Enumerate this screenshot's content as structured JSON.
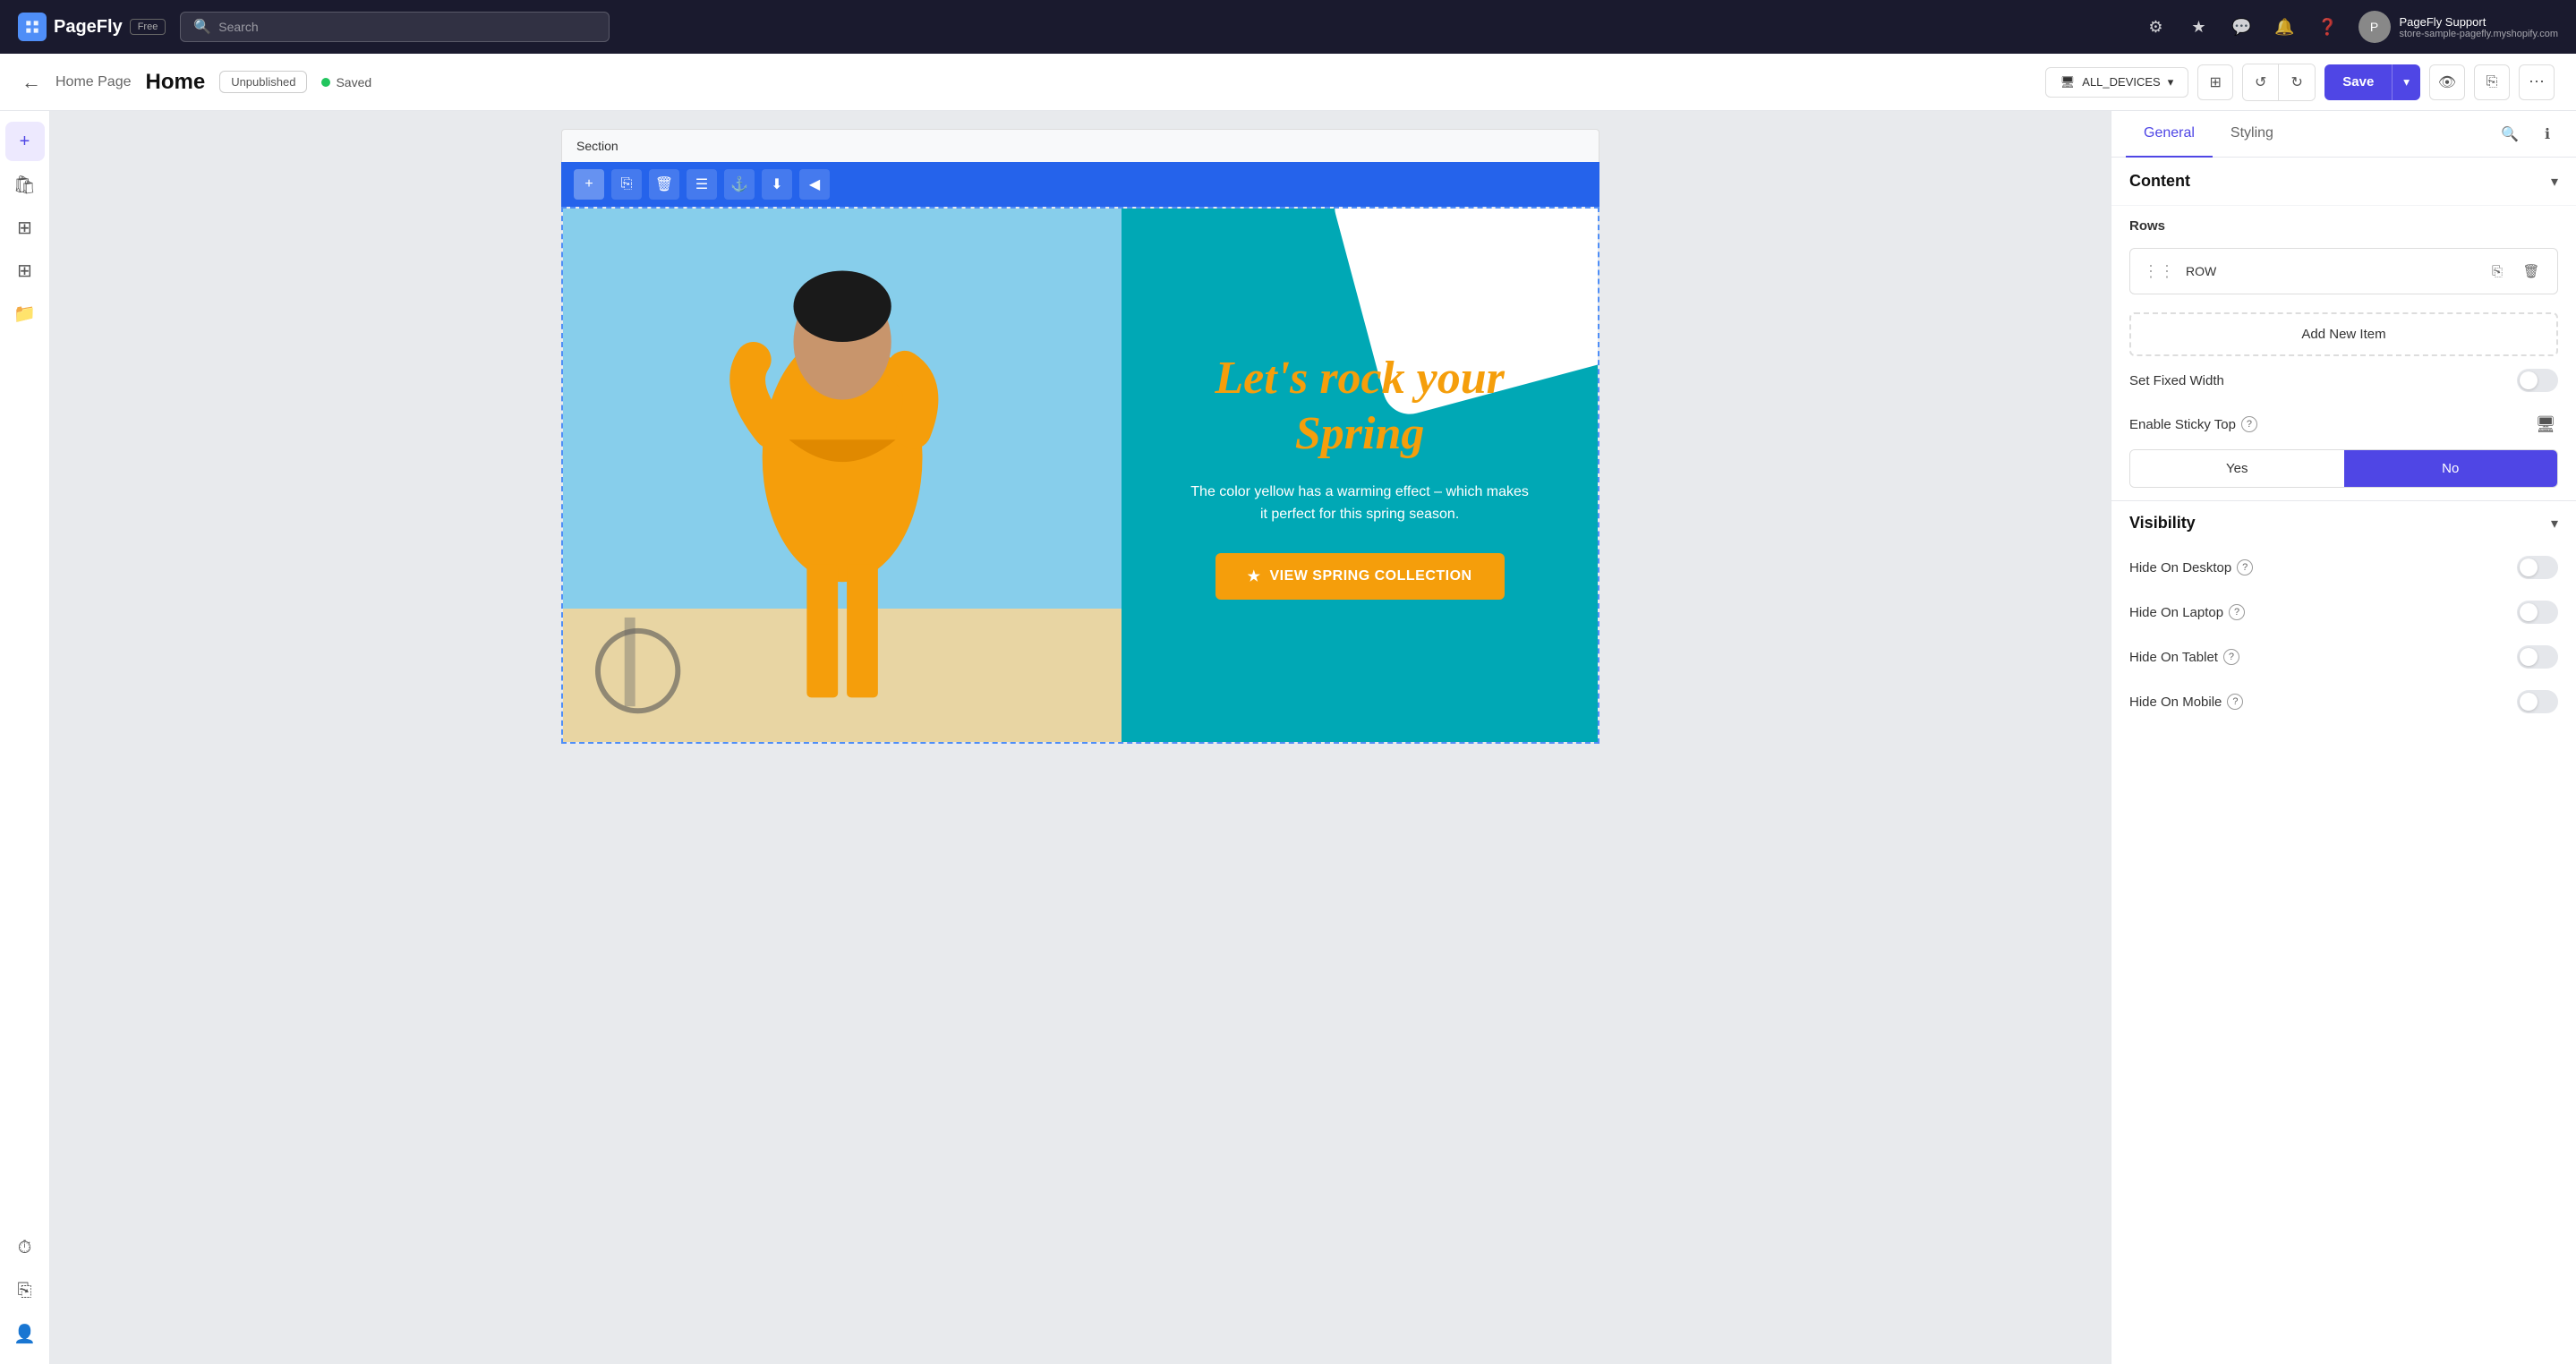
{
  "app": {
    "name": "PageFly",
    "badge": "Free"
  },
  "search": {
    "placeholder": "Search"
  },
  "user": {
    "name": "PageFly Support",
    "store": "store-sample-pagefly.myshopify.com",
    "initials": "P"
  },
  "header": {
    "back_label": "←",
    "page_parent": "Home Page",
    "page_title": "Home",
    "status": "Unpublished",
    "saved": "Saved",
    "device": "ALL_DEVICES",
    "save_label": "Save"
  },
  "section": {
    "label": "Section"
  },
  "hero": {
    "headline": "Let's rock your Spring",
    "subtext": "The color yellow has a warming effect – which makes it perfect for this spring season.",
    "cta_label": "VIEW SPRING COLLECTION"
  },
  "toolbar": {
    "buttons": [
      "add",
      "copy",
      "delete",
      "layers",
      "anchor",
      "download",
      "arrow"
    ]
  },
  "panel": {
    "tabs": [
      {
        "label": "General",
        "active": true
      },
      {
        "label": "Styling",
        "active": false
      }
    ],
    "content": {
      "title": "Content",
      "rows_label": "Rows",
      "row_item": "ROW",
      "add_new_item": "Add New Item",
      "set_fixed_width": "Set Fixed Width",
      "enable_sticky_top": "Enable Sticky Top",
      "yes_label": "Yes",
      "no_label": "No"
    },
    "visibility": {
      "title": "Visibility",
      "hide_desktop": "Hide On Desktop",
      "hide_laptop": "Hide On Laptop",
      "hide_tablet": "Hide On Tablet",
      "hide_mobile": "Hide On Mobile"
    }
  }
}
